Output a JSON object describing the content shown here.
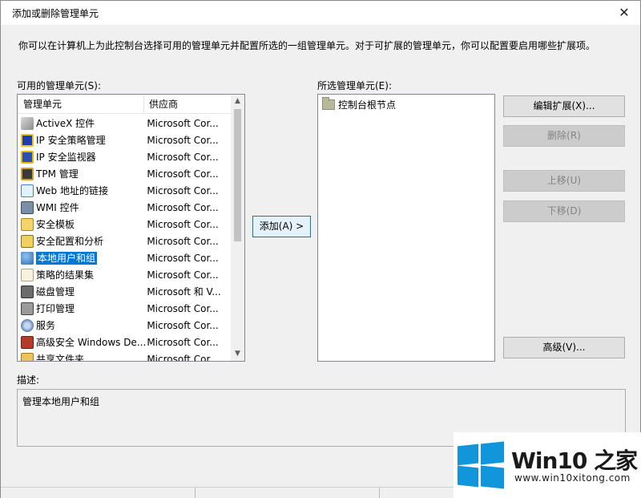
{
  "window": {
    "title": "添加或删除管理单元",
    "close_glyph": "✕"
  },
  "intro_text": "你可以在计算机上为此控制台选择可用的管理单元并配置所选的一组管理单元。对于可扩展的管理单元，你可以配置要启用哪些扩展项。",
  "available": {
    "label": "可用的管理单元(S):",
    "columns": [
      "管理单元",
      "供应商"
    ],
    "items": [
      {
        "name": "ActiveX 控件",
        "vendor": "Microsoft Cor...",
        "icon": "activex-control-icon"
      },
      {
        "name": "IP 安全策略管理",
        "vendor": "Microsoft Cor...",
        "icon": "ip-security-policy-icon"
      },
      {
        "name": "IP 安全监视器",
        "vendor": "Microsoft Cor...",
        "icon": "ip-security-monitor-icon"
      },
      {
        "name": "TPM 管理",
        "vendor": "Microsoft Cor...",
        "icon": "tpm-management-icon"
      },
      {
        "name": "Web 地址的链接",
        "vendor": "Microsoft Cor...",
        "icon": "web-link-icon"
      },
      {
        "name": "WMI 控件",
        "vendor": "Microsoft Cor...",
        "icon": "wmi-control-icon"
      },
      {
        "name": "安全模板",
        "vendor": "Microsoft Cor...",
        "icon": "security-template-icon"
      },
      {
        "name": "安全配置和分析",
        "vendor": "Microsoft Cor...",
        "icon": "security-config-icon"
      },
      {
        "name": "本地用户和组",
        "vendor": "Microsoft Cor...",
        "icon": "local-users-groups-icon",
        "selected": true
      },
      {
        "name": "策略的结果集",
        "vendor": "Microsoft Cor...",
        "icon": "rsop-icon"
      },
      {
        "name": "磁盘管理",
        "vendor": "Microsoft 和 V...",
        "icon": "disk-management-icon"
      },
      {
        "name": "打印管理",
        "vendor": "Microsoft Cor...",
        "icon": "print-management-icon"
      },
      {
        "name": "服务",
        "vendor": "Microsoft Cor...",
        "icon": "services-icon"
      },
      {
        "name": "高级安全 Windows De...",
        "vendor": "Microsoft Cor...",
        "icon": "firewall-icon"
      },
      {
        "name": "共享文件夹",
        "vendor": "Microsoft Cor...",
        "icon": "shared-folders-icon"
      }
    ]
  },
  "selected_panel": {
    "label": "所选管理单元(E):",
    "root": "控制台根节点"
  },
  "buttons": {
    "add": "添加(A) >",
    "edit_extensions": "编辑扩展(X)...",
    "remove": "删除(R)",
    "move_up": "上移(U)",
    "move_down": "下移(D)",
    "advanced": "高级(V)..."
  },
  "description": {
    "label": "描述:",
    "text": "管理本地用户和组"
  },
  "watermark": {
    "title": "Win10 之家",
    "url": "www.win10xitong.com"
  },
  "colors": {
    "selection": "#0078d7",
    "watermark_blue": "#1296db"
  }
}
